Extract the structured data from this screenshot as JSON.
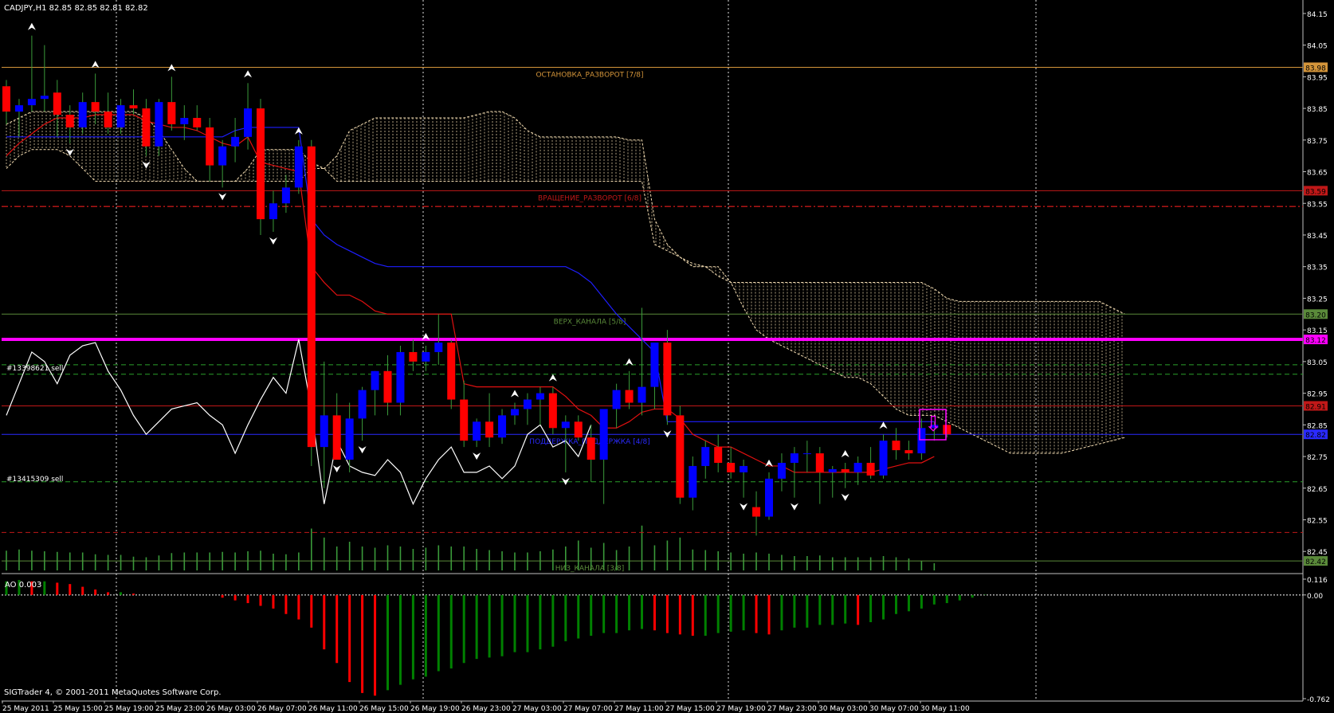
{
  "header": {
    "symbol_info": "CADJPY,H1  82.85 82.85 82.81 82.82"
  },
  "ao": {
    "label": "AO 0.003",
    "ticks": [
      "0.116",
      "0.00",
      "-0.762"
    ]
  },
  "footer": {
    "copyright": "SIGTrader 4, © 2001-2011 MetaQuotes Software Corp."
  },
  "colors": {
    "bull_candle": "#0000ff",
    "bear_candle": "#ff0000",
    "cloud": "#f5deb3",
    "kijun": "#1e1eff",
    "tenkan": "#e01010",
    "chikou": "#ffffff",
    "magenta_level": "#ff00ff",
    "volume": "#3a9a3a",
    "ao_up": "#008000",
    "ao_down": "#ff0000"
  },
  "chart_data": {
    "type": "line",
    "title": "CADJPY,H1",
    "ylim": [
      82.38,
      84.18
    ],
    "y_ticks": [
      "84.15",
      "84.05",
      "83.95",
      "83.85",
      "83.75",
      "83.65",
      "83.55",
      "83.45",
      "83.35",
      "83.25",
      "83.15",
      "83.05",
      "82.95",
      "82.85",
      "82.75",
      "82.65",
      "82.55",
      "82.45"
    ],
    "x_ticks": [
      "25 May 2011",
      "25 May 15:00",
      "25 May 19:00",
      "25 May 23:00",
      "26 May 03:00",
      "26 May 07:00",
      "26 May 11:00",
      "26 May 15:00",
      "26 May 19:00",
      "26 May 23:00",
      "27 May 03:00",
      "27 May 07:00",
      "27 May 11:00",
      "27 May 15:00",
      "27 May 19:00",
      "27 May 23:00",
      "30 May 03:00",
      "30 May 07:00",
      "30 May 11:00"
    ],
    "levels": [
      {
        "label": "ОСТАНОВКА_РАЗВОРОТ [7/8]",
        "tag": "83.98",
        "value": 83.98,
        "color": "#d4953a",
        "style": "solid"
      },
      {
        "label": "ВРАЩЕНИЕ_РАЗВОРОТ [6/8]",
        "tag": "83.59",
        "value": 83.59,
        "color": "#c01818",
        "style": "solid"
      },
      {
        "label": "",
        "tag": "",
        "value": 83.54,
        "color": "#c01818",
        "style": "dashdot"
      },
      {
        "label": "ВЕРХ_КАНАЛА [5/8]",
        "tag": "83.20",
        "value": 83.2,
        "color": "#5a8a3a",
        "style": "solid"
      },
      {
        "label": "",
        "tag": "83.12",
        "value": 83.12,
        "color": "#ff00ff",
        "style": "thick"
      },
      {
        "label": "",
        "tag": "",
        "value": 83.04,
        "color": "#2aa02a",
        "style": "dash"
      },
      {
        "label": "",
        "tag": "",
        "value": 83.01,
        "color": "#2aa02a",
        "style": "dash"
      },
      {
        "label": "",
        "tag": "82.91",
        "value": 82.91,
        "color": "#c01818",
        "style": "solid"
      },
      {
        "label": "ПОДДЕРЖКА_ПОДДЕРЖКА [4/8]",
        "tag": "82.82",
        "value": 82.82,
        "color": "#2a2aff",
        "style": "solid"
      },
      {
        "label": "",
        "tag": "",
        "value": 82.67,
        "color": "#2aa02a",
        "style": "dash"
      },
      {
        "label": "",
        "tag": "",
        "value": 82.51,
        "color": "#c01818",
        "style": "dash"
      },
      {
        "label": "НИЗ_КАНАЛА [3/8]",
        "tag": "82.42",
        "value": 82.42,
        "color": "#5a8a3a",
        "style": "solid"
      }
    ],
    "order_labels": [
      {
        "text": "#13398621 sell",
        "value": 83.03
      },
      {
        "text": "#13415309 sell",
        "value": 82.68
      }
    ],
    "candles": [
      [
        83.92,
        83.94,
        83.8,
        83.84
      ],
      [
        83.84,
        83.88,
        83.76,
        83.86
      ],
      [
        83.86,
        84.08,
        83.84,
        83.88
      ],
      [
        83.88,
        84.05,
        83.84,
        83.89
      ],
      [
        83.9,
        83.94,
        83.76,
        83.83
      ],
      [
        83.83,
        83.86,
        83.74,
        83.79
      ],
      [
        83.79,
        83.9,
        83.77,
        83.87
      ],
      [
        83.87,
        83.96,
        83.8,
        83.84
      ],
      [
        83.84,
        83.9,
        83.77,
        83.79
      ],
      [
        83.79,
        83.88,
        83.77,
        83.86
      ],
      [
        83.86,
        83.91,
        83.83,
        83.85
      ],
      [
        83.85,
        83.88,
        83.7,
        83.73
      ],
      [
        83.73,
        83.88,
        83.7,
        83.87
      ],
      [
        83.87,
        83.95,
        83.78,
        83.8
      ],
      [
        83.8,
        83.86,
        83.75,
        83.82
      ],
      [
        83.82,
        83.86,
        83.78,
        83.79
      ],
      [
        83.79,
        83.82,
        83.62,
        83.67
      ],
      [
        83.67,
        83.75,
        83.6,
        83.73
      ],
      [
        83.73,
        83.82,
        83.68,
        83.76
      ],
      [
        83.76,
        83.93,
        83.72,
        83.85
      ],
      [
        83.85,
        83.88,
        83.45,
        83.5
      ],
      [
        83.5,
        83.59,
        83.46,
        83.55
      ],
      [
        83.55,
        83.64,
        83.52,
        83.6
      ],
      [
        83.6,
        83.75,
        83.58,
        83.73
      ],
      [
        83.73,
        83.75,
        82.72,
        82.78
      ],
      [
        82.78,
        83.05,
        82.65,
        82.88
      ],
      [
        82.88,
        82.95,
        82.74,
        82.74
      ],
      [
        82.74,
        82.92,
        82.7,
        82.87
      ],
      [
        82.87,
        82.97,
        82.8,
        82.96
      ],
      [
        82.96,
        83.02,
        82.88,
        83.02
      ],
      [
        83.02,
        83.07,
        82.88,
        82.92
      ],
      [
        82.92,
        83.1,
        82.88,
        83.08
      ],
      [
        83.08,
        83.12,
        83.02,
        83.05
      ],
      [
        83.05,
        83.1,
        83.02,
        83.08
      ],
      [
        83.08,
        83.2,
        83.04,
        83.11
      ],
      [
        83.11,
        83.12,
        82.9,
        82.93
      ],
      [
        82.93,
        82.99,
        82.78,
        82.8
      ],
      [
        82.8,
        82.87,
        82.78,
        82.86
      ],
      [
        82.86,
        82.95,
        82.78,
        82.81
      ],
      [
        82.81,
        82.9,
        82.79,
        82.88
      ],
      [
        82.88,
        82.92,
        82.85,
        82.9
      ],
      [
        82.9,
        82.95,
        82.85,
        82.93
      ],
      [
        82.93,
        82.97,
        82.85,
        82.95
      ],
      [
        82.95,
        82.97,
        82.82,
        82.84
      ],
      [
        82.84,
        82.88,
        82.7,
        82.86
      ],
      [
        82.86,
        82.88,
        82.8,
        82.81
      ],
      [
        82.81,
        82.85,
        82.67,
        82.74
      ],
      [
        82.74,
        82.82,
        82.6,
        82.9
      ],
      [
        82.9,
        82.98,
        82.84,
        82.96
      ],
      [
        82.96,
        83.02,
        82.9,
        82.92
      ],
      [
        82.92,
        83.22,
        82.88,
        82.97
      ],
      [
        82.97,
        83.06,
        82.9,
        83.11
      ],
      [
        83.11,
        83.15,
        82.85,
        82.88
      ],
      [
        82.88,
        82.91,
        82.6,
        82.62
      ],
      [
        82.62,
        82.75,
        82.58,
        82.72
      ],
      [
        82.72,
        82.8,
        82.68,
        82.78
      ],
      [
        82.78,
        82.82,
        82.7,
        82.73
      ],
      [
        82.73,
        82.78,
        82.68,
        82.7
      ],
      [
        82.7,
        82.74,
        82.62,
        82.72
      ],
      [
        82.59,
        82.64,
        82.5,
        82.56
      ],
      [
        82.56,
        82.7,
        82.55,
        82.68
      ],
      [
        82.68,
        82.76,
        82.64,
        82.73
      ],
      [
        82.73,
        82.78,
        82.62,
        82.76
      ],
      [
        82.76,
        82.8,
        82.7,
        82.76
      ],
      [
        82.76,
        82.78,
        82.6,
        82.7
      ],
      [
        82.7,
        82.72,
        82.62,
        82.71
      ],
      [
        82.71,
        82.73,
        82.65,
        82.7
      ],
      [
        82.7,
        82.75,
        82.66,
        82.73
      ],
      [
        82.73,
        82.78,
        82.68,
        82.69
      ],
      [
        82.69,
        82.82,
        82.68,
        82.8
      ],
      [
        82.8,
        82.84,
        82.74,
        82.77
      ],
      [
        82.77,
        82.8,
        82.74,
        82.76
      ],
      [
        82.76,
        82.87,
        82.74,
        82.84
      ],
      [
        82.84,
        82.86,
        82.8,
        82.85
      ],
      [
        82.85,
        82.85,
        82.81,
        82.82
      ]
    ],
    "tenkan": [
      83.7,
      83.74,
      83.77,
      83.8,
      83.82,
      83.82,
      83.82,
      83.83,
      83.83,
      83.83,
      83.83,
      83.81,
      83.8,
      83.79,
      83.79,
      83.78,
      83.76,
      83.74,
      83.73,
      83.76,
      83.68,
      83.67,
      83.66,
      83.65,
      83.35,
      83.3,
      83.26,
      83.26,
      83.24,
      83.21,
      83.2,
      83.2,
      83.2,
      83.2,
      83.2,
      83.2,
      82.98,
      82.97,
      82.97,
      82.97,
      82.97,
      82.97,
      82.97,
      82.97,
      82.94,
      82.9,
      82.88,
      82.84,
      82.84,
      82.86,
      82.89,
      82.9,
      82.9,
      82.87,
      82.82,
      82.8,
      82.78,
      82.78,
      82.76,
      82.74,
      82.72,
      82.72,
      82.7,
      82.7,
      82.7,
      82.7,
      82.7,
      82.7,
      82.7,
      82.71,
      82.72,
      82.73,
      82.73,
      82.75
    ],
    "kijun": [
      83.76,
      83.76,
      83.76,
      83.76,
      83.76,
      83.76,
      83.76,
      83.76,
      83.76,
      83.76,
      83.76,
      83.76,
      83.76,
      83.76,
      83.76,
      83.76,
      83.76,
      83.76,
      83.78,
      83.79,
      83.79,
      83.79,
      83.79,
      83.79,
      83.5,
      83.45,
      83.42,
      83.4,
      83.38,
      83.36,
      83.35,
      83.35,
      83.35,
      83.35,
      83.35,
      83.35,
      83.35,
      83.35,
      83.35,
      83.35,
      83.35,
      83.35,
      83.35,
      83.35,
      83.35,
      83.33,
      83.3,
      83.25,
      83.2,
      83.16,
      83.12,
      83.08,
      82.86,
      82.86,
      82.86,
      82.86,
      82.86,
      82.86,
      82.86,
      82.86,
      82.86,
      82.86,
      82.86,
      82.86,
      82.86,
      82.86,
      82.86,
      82.86,
      82.86,
      82.86,
      82.86,
      82.86,
      82.86,
      82.86
    ],
    "chikou": [
      82.88,
      82.98,
      83.08,
      83.05,
      82.98,
      83.07,
      83.1,
      83.11,
      83.02,
      82.96,
      82.88,
      82.82,
      82.86,
      82.9,
      82.91,
      82.92,
      82.88,
      82.85,
      82.76,
      82.85,
      82.93,
      83.0,
      82.95,
      83.12,
      82.9,
      82.6,
      82.8,
      82.72,
      82.7,
      82.69,
      82.74,
      82.7,
      82.6,
      82.68,
      82.74,
      82.78,
      82.7,
      82.7,
      82.72,
      82.68,
      82.72,
      82.82,
      82.85,
      82.78,
      82.8,
      82.75,
      82.85
    ],
    "cloud_a": [
      83.8,
      83.82,
      83.84,
      83.84,
      83.84,
      83.84,
      83.84,
      83.84,
      83.84,
      83.84,
      83.84,
      83.82,
      83.78,
      83.72,
      83.66,
      83.62,
      83.62,
      83.62,
      83.62,
      83.66,
      83.72,
      83.72,
      83.72,
      83.72,
      83.68,
      83.66,
      83.7,
      83.78,
      83.8,
      83.82,
      83.82,
      83.82,
      83.82,
      83.82,
      83.82,
      83.82,
      83.82,
      83.83,
      83.84,
      83.84,
      83.82,
      83.78,
      83.76,
      83.76,
      83.76,
      83.76,
      83.76,
      83.76,
      83.76,
      83.75,
      83.75,
      83.5,
      83.42,
      83.38,
      83.35,
      83.35,
      83.35,
      83.3,
      83.3,
      83.3,
      83.3,
      83.3,
      83.3,
      83.3,
      83.3,
      83.3,
      83.3,
      83.3,
      83.3,
      83.3,
      83.3,
      83.3,
      83.3,
      83.28,
      83.25,
      83.24,
      83.24,
      83.24,
      83.24,
      83.24,
      83.24,
      83.24,
      83.24,
      83.24,
      83.24,
      83.24,
      83.24,
      83.22,
      83.2
    ],
    "cloud_b": [
      83.66,
      83.7,
      83.72,
      83.72,
      83.72,
      83.7,
      83.66,
      83.62,
      83.62,
      83.62,
      83.62,
      83.62,
      83.62,
      83.62,
      83.62,
      83.62,
      83.62,
      83.62,
      83.62,
      83.62,
      83.62,
      83.62,
      83.62,
      83.62,
      83.66,
      83.66,
      83.62,
      83.62,
      83.62,
      83.62,
      83.62,
      83.62,
      83.62,
      83.62,
      83.62,
      83.62,
      83.62,
      83.62,
      83.62,
      83.62,
      83.62,
      83.62,
      83.62,
      83.62,
      83.62,
      83.62,
      83.62,
      83.62,
      83.62,
      83.62,
      83.62,
      83.42,
      83.4,
      83.38,
      83.36,
      83.35,
      83.32,
      83.3,
      83.22,
      83.15,
      83.12,
      83.1,
      83.08,
      83.06,
      83.04,
      83.02,
      83.0,
      83.0,
      82.98,
      82.94,
      82.9,
      82.88,
      82.88,
      82.88,
      82.86,
      82.84,
      82.82,
      82.8,
      82.78,
      82.76,
      82.76,
      82.76,
      82.76,
      82.76,
      82.77,
      82.78,
      82.79,
      82.8,
      82.81
    ],
    "volume": [
      0.33,
      0.35,
      0.33,
      0.32,
      0.31,
      0.3,
      0.3,
      0.27,
      0.26,
      0.26,
      0.23,
      0.22,
      0.25,
      0.29,
      0.3,
      0.3,
      0.3,
      0.31,
      0.3,
      0.32,
      0.33,
      0.28,
      0.27,
      0.3,
      0.7,
      0.55,
      0.4,
      0.48,
      0.4,
      0.38,
      0.42,
      0.4,
      0.36,
      0.38,
      0.42,
      0.4,
      0.4,
      0.36,
      0.34,
      0.32,
      0.3,
      0.3,
      0.32,
      0.35,
      0.4,
      0.5,
      0.38,
      0.46,
      0.34,
      0.4,
      0.75,
      0.42,
      0.5,
      0.55,
      0.35,
      0.34,
      0.32,
      0.3,
      0.28,
      0.3,
      0.28,
      0.26,
      0.24,
      0.24,
      0.25,
      0.22,
      0.22,
      0.22,
      0.22,
      0.24,
      0.22,
      0.2,
      0.16,
      0.12
    ],
    "ao_values": [
      0.1,
      0.11,
      0.1,
      0.1,
      0.09,
      0.08,
      0.06,
      0.04,
      0.02,
      0.02,
      0.01,
      0.0,
      0.0,
      0.0,
      0.0,
      0.0,
      0.0,
      -0.02,
      -0.04,
      -0.06,
      -0.08,
      -0.1,
      -0.14,
      -0.18,
      -0.24,
      -0.4,
      -0.5,
      -0.64,
      -0.72,
      -0.74,
      -0.7,
      -0.66,
      -0.62,
      -0.6,
      -0.56,
      -0.54,
      -0.5,
      -0.47,
      -0.46,
      -0.45,
      -0.42,
      -0.42,
      -0.4,
      -0.38,
      -0.34,
      -0.32,
      -0.3,
      -0.28,
      -0.28,
      -0.26,
      -0.25,
      -0.26,
      -0.28,
      -0.29,
      -0.3,
      -0.3,
      -0.28,
      -0.27,
      -0.26,
      -0.28,
      -0.29,
      -0.26,
      -0.24,
      -0.24,
      -0.22,
      -0.22,
      -0.21,
      -0.22,
      -0.2,
      -0.18,
      -0.14,
      -0.12,
      -0.1,
      -0.07,
      -0.06,
      -0.04,
      -0.02,
      0.003
    ],
    "fractals_up": [
      2,
      7,
      13,
      19,
      23,
      33,
      40,
      43,
      49,
      60,
      66,
      69
    ],
    "fractals_down": [
      5,
      11,
      17,
      21,
      26,
      28,
      37,
      44,
      52,
      58,
      62,
      66
    ],
    "signal_arrow": "⇩"
  }
}
